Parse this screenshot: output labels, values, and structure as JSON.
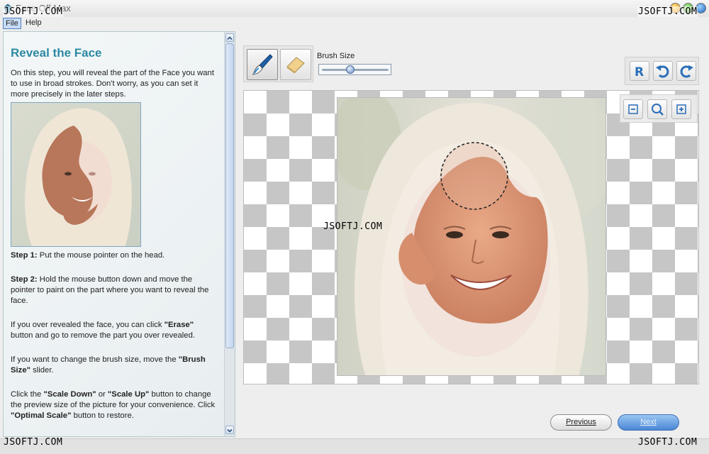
{
  "window": {
    "title": "Face Off Max",
    "watermark": "JSOFTJ.COM"
  },
  "menu": [
    {
      "label": "File"
    },
    {
      "label": "Help"
    }
  ],
  "panel": {
    "title": "Reveal the Face",
    "intro": "On this step, you will reveal the part of the Face you want to use in broad strokes. Don't worry, as you can set it more precisely in the later steps.",
    "step1_label": "Step 1:",
    "step1_text": " Put the mouse pointer on the head.",
    "step2_label": "Step 2:",
    "step2_text": " Hold the mouse button down and move the pointer to paint on the part where you want to reveal the face.",
    "erase_pre": "If you over revealed the face, you can click ",
    "erase_bold": "\"Erase\"",
    "erase_post": " button and go to remove the part you over revealed.",
    "brush_pre": "If you want to change the brush size, move the ",
    "brush_bold": "\"Brush Size\"",
    "brush_post": " slider.",
    "scale_pre": "Click the ",
    "scale_down": "\"Scale Down\"",
    "scale_or": " or ",
    "scale_up": "\"Scale Up\"",
    "scale_mid": " button to change the preview size of the picture for your convenience. Click ",
    "scale_opt": "\"Optimal Scale\"",
    "scale_post": " button to restore."
  },
  "toolbar": {
    "brush_tool": "brush-icon",
    "erase_tool": "eraser-icon",
    "brush_size_label": "Brush Size",
    "brush_size_fraction": 0.42
  },
  "buttons": {
    "previous": "Previous",
    "next": "Next"
  },
  "colors": {
    "title_accent": "#2d8aa2",
    "next_button": "#4a86d4"
  }
}
